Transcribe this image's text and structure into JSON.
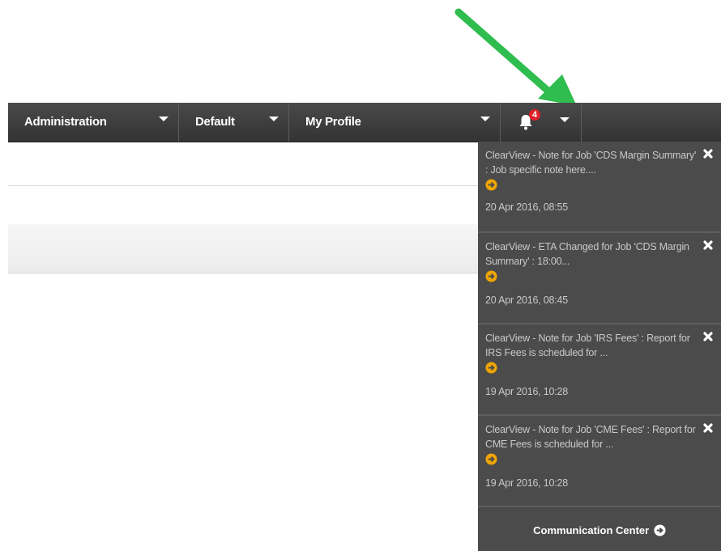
{
  "navbar": {
    "items": [
      {
        "label": "Administration"
      },
      {
        "label": "Default"
      },
      {
        "label": "My Profile"
      }
    ],
    "notifications": {
      "count": "4",
      "bell_icon": "bell-icon"
    }
  },
  "notifications": [
    {
      "message": "ClearView - Note for Job 'CDS Margin Summary' : Job specific note here....",
      "time": "20 Apr 2016, 08:55"
    },
    {
      "message": "ClearView - ETA Changed for Job 'CDS Margin Summary' : 18:00...",
      "time": "20 Apr 2016, 08:45"
    },
    {
      "message": "ClearView - Note for Job 'IRS Fees' : Report for IRS Fees is scheduled for ...",
      "time": "19 Apr 2016, 10:28"
    },
    {
      "message": "ClearView - Note for Job 'CME Fees' : Report for CME Fees is scheduled for ...",
      "time": "19 Apr 2016, 10:28"
    }
  ],
  "footer": {
    "label": "Communication Center"
  },
  "colors": {
    "annotation_arrow": "#2ebd4e",
    "badge": "#e0202a",
    "go_icon": "#f0a500",
    "navbar": "#3d3d3d",
    "dropdown": "#4b4b4b"
  }
}
